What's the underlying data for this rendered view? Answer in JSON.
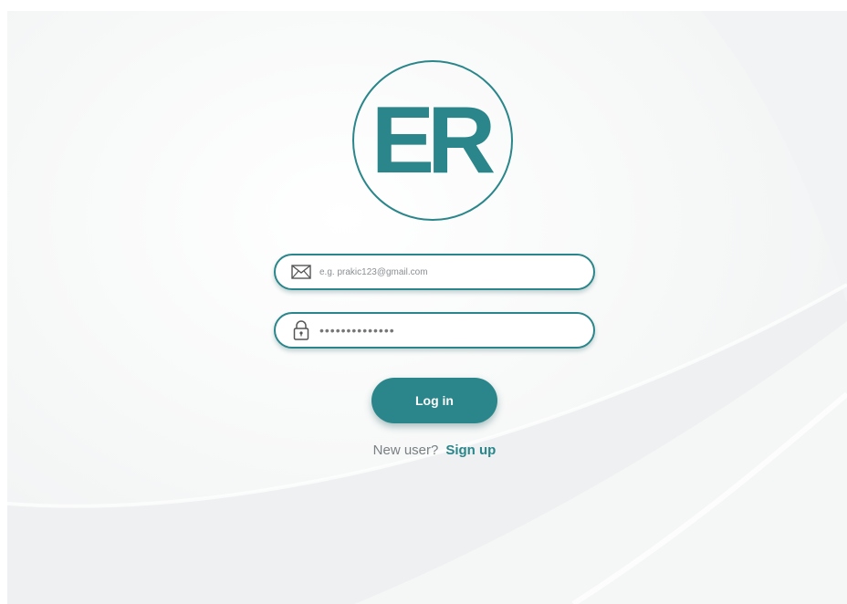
{
  "logo": {
    "text": "ER",
    "brand_color": "#2a868a"
  },
  "email_field": {
    "placeholder": "e.g. prakic123@gmail.com",
    "icon": "mail-icon"
  },
  "password_field": {
    "value": "••••••••••••••",
    "icon": "lock-icon"
  },
  "login_button": {
    "label": "Log in"
  },
  "signup": {
    "prompt": "New user?",
    "link_label": "Sign up"
  }
}
